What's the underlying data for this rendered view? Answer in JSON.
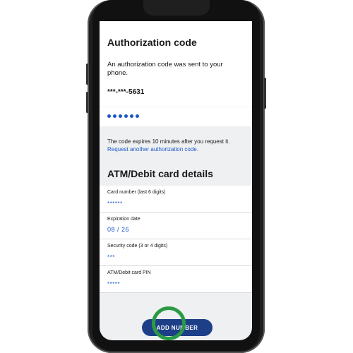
{
  "auth": {
    "title": "Authorization code",
    "message": "An authorization code was sent to your phone.",
    "phone_masked": "***-***-5631",
    "code_dots": 6,
    "expiry_text": "The code expires 10 minutes after you request it.",
    "request_link": "Request another authorization code."
  },
  "card": {
    "title": "ATM/Debit card details",
    "fields": [
      {
        "label": "Card number (last 6 digits)",
        "value": "******"
      },
      {
        "label": "Expiration date",
        "value": "08 / 26"
      },
      {
        "label": "Security code (3 or 4 digits)",
        "value": "***"
      },
      {
        "label": "ATM/Debit card PIN",
        "value": "*****"
      }
    ]
  },
  "footer": {
    "add_button": "ADD NUMBER"
  },
  "colors": {
    "accent": "#1a57c8",
    "button": "#1d3f88",
    "highlight_ring": "#2b9a44"
  }
}
